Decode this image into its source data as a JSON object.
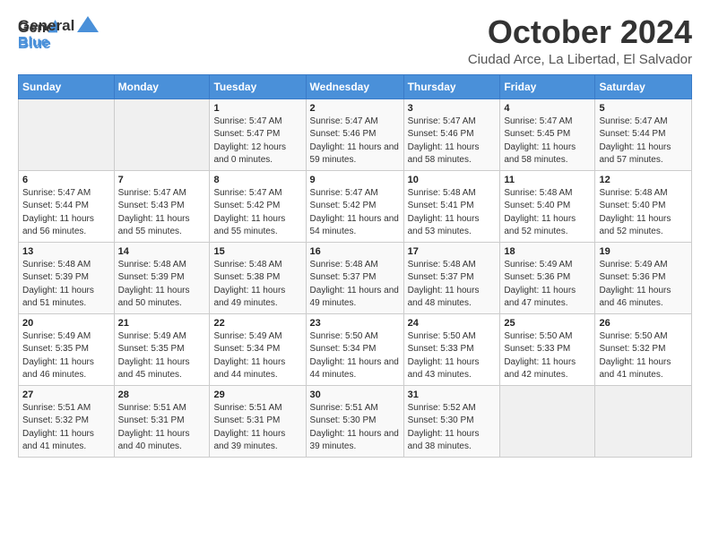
{
  "header": {
    "logo_line1": "General",
    "logo_line2": "Blue",
    "main_title": "October 2024",
    "subtitle": "Ciudad Arce, La Libertad, El Salvador"
  },
  "days_of_week": [
    "Sunday",
    "Monday",
    "Tuesday",
    "Wednesday",
    "Thursday",
    "Friday",
    "Saturday"
  ],
  "weeks": [
    [
      {
        "day": "",
        "sunrise": "",
        "sunset": "",
        "daylight": ""
      },
      {
        "day": "",
        "sunrise": "",
        "sunset": "",
        "daylight": ""
      },
      {
        "day": "1",
        "sunrise": "Sunrise: 5:47 AM",
        "sunset": "Sunset: 5:47 PM",
        "daylight": "Daylight: 12 hours and 0 minutes."
      },
      {
        "day": "2",
        "sunrise": "Sunrise: 5:47 AM",
        "sunset": "Sunset: 5:46 PM",
        "daylight": "Daylight: 11 hours and 59 minutes."
      },
      {
        "day": "3",
        "sunrise": "Sunrise: 5:47 AM",
        "sunset": "Sunset: 5:46 PM",
        "daylight": "Daylight: 11 hours and 58 minutes."
      },
      {
        "day": "4",
        "sunrise": "Sunrise: 5:47 AM",
        "sunset": "Sunset: 5:45 PM",
        "daylight": "Daylight: 11 hours and 58 minutes."
      },
      {
        "day": "5",
        "sunrise": "Sunrise: 5:47 AM",
        "sunset": "Sunset: 5:44 PM",
        "daylight": "Daylight: 11 hours and 57 minutes."
      }
    ],
    [
      {
        "day": "6",
        "sunrise": "Sunrise: 5:47 AM",
        "sunset": "Sunset: 5:44 PM",
        "daylight": "Daylight: 11 hours and 56 minutes."
      },
      {
        "day": "7",
        "sunrise": "Sunrise: 5:47 AM",
        "sunset": "Sunset: 5:43 PM",
        "daylight": "Daylight: 11 hours and 55 minutes."
      },
      {
        "day": "8",
        "sunrise": "Sunrise: 5:47 AM",
        "sunset": "Sunset: 5:42 PM",
        "daylight": "Daylight: 11 hours and 55 minutes."
      },
      {
        "day": "9",
        "sunrise": "Sunrise: 5:47 AM",
        "sunset": "Sunset: 5:42 PM",
        "daylight": "Daylight: 11 hours and 54 minutes."
      },
      {
        "day": "10",
        "sunrise": "Sunrise: 5:48 AM",
        "sunset": "Sunset: 5:41 PM",
        "daylight": "Daylight: 11 hours and 53 minutes."
      },
      {
        "day": "11",
        "sunrise": "Sunrise: 5:48 AM",
        "sunset": "Sunset: 5:40 PM",
        "daylight": "Daylight: 11 hours and 52 minutes."
      },
      {
        "day": "12",
        "sunrise": "Sunrise: 5:48 AM",
        "sunset": "Sunset: 5:40 PM",
        "daylight": "Daylight: 11 hours and 52 minutes."
      }
    ],
    [
      {
        "day": "13",
        "sunrise": "Sunrise: 5:48 AM",
        "sunset": "Sunset: 5:39 PM",
        "daylight": "Daylight: 11 hours and 51 minutes."
      },
      {
        "day": "14",
        "sunrise": "Sunrise: 5:48 AM",
        "sunset": "Sunset: 5:39 PM",
        "daylight": "Daylight: 11 hours and 50 minutes."
      },
      {
        "day": "15",
        "sunrise": "Sunrise: 5:48 AM",
        "sunset": "Sunset: 5:38 PM",
        "daylight": "Daylight: 11 hours and 49 minutes."
      },
      {
        "day": "16",
        "sunrise": "Sunrise: 5:48 AM",
        "sunset": "Sunset: 5:37 PM",
        "daylight": "Daylight: 11 hours and 49 minutes."
      },
      {
        "day": "17",
        "sunrise": "Sunrise: 5:48 AM",
        "sunset": "Sunset: 5:37 PM",
        "daylight": "Daylight: 11 hours and 48 minutes."
      },
      {
        "day": "18",
        "sunrise": "Sunrise: 5:49 AM",
        "sunset": "Sunset: 5:36 PM",
        "daylight": "Daylight: 11 hours and 47 minutes."
      },
      {
        "day": "19",
        "sunrise": "Sunrise: 5:49 AM",
        "sunset": "Sunset: 5:36 PM",
        "daylight": "Daylight: 11 hours and 46 minutes."
      }
    ],
    [
      {
        "day": "20",
        "sunrise": "Sunrise: 5:49 AM",
        "sunset": "Sunset: 5:35 PM",
        "daylight": "Daylight: 11 hours and 46 minutes."
      },
      {
        "day": "21",
        "sunrise": "Sunrise: 5:49 AM",
        "sunset": "Sunset: 5:35 PM",
        "daylight": "Daylight: 11 hours and 45 minutes."
      },
      {
        "day": "22",
        "sunrise": "Sunrise: 5:49 AM",
        "sunset": "Sunset: 5:34 PM",
        "daylight": "Daylight: 11 hours and 44 minutes."
      },
      {
        "day": "23",
        "sunrise": "Sunrise: 5:50 AM",
        "sunset": "Sunset: 5:34 PM",
        "daylight": "Daylight: 11 hours and 44 minutes."
      },
      {
        "day": "24",
        "sunrise": "Sunrise: 5:50 AM",
        "sunset": "Sunset: 5:33 PM",
        "daylight": "Daylight: 11 hours and 43 minutes."
      },
      {
        "day": "25",
        "sunrise": "Sunrise: 5:50 AM",
        "sunset": "Sunset: 5:33 PM",
        "daylight": "Daylight: 11 hours and 42 minutes."
      },
      {
        "day": "26",
        "sunrise": "Sunrise: 5:50 AM",
        "sunset": "Sunset: 5:32 PM",
        "daylight": "Daylight: 11 hours and 41 minutes."
      }
    ],
    [
      {
        "day": "27",
        "sunrise": "Sunrise: 5:51 AM",
        "sunset": "Sunset: 5:32 PM",
        "daylight": "Daylight: 11 hours and 41 minutes."
      },
      {
        "day": "28",
        "sunrise": "Sunrise: 5:51 AM",
        "sunset": "Sunset: 5:31 PM",
        "daylight": "Daylight: 11 hours and 40 minutes."
      },
      {
        "day": "29",
        "sunrise": "Sunrise: 5:51 AM",
        "sunset": "Sunset: 5:31 PM",
        "daylight": "Daylight: 11 hours and 39 minutes."
      },
      {
        "day": "30",
        "sunrise": "Sunrise: 5:51 AM",
        "sunset": "Sunset: 5:30 PM",
        "daylight": "Daylight: 11 hours and 39 minutes."
      },
      {
        "day": "31",
        "sunrise": "Sunrise: 5:52 AM",
        "sunset": "Sunset: 5:30 PM",
        "daylight": "Daylight: 11 hours and 38 minutes."
      },
      {
        "day": "",
        "sunrise": "",
        "sunset": "",
        "daylight": ""
      },
      {
        "day": "",
        "sunrise": "",
        "sunset": "",
        "daylight": ""
      }
    ]
  ]
}
